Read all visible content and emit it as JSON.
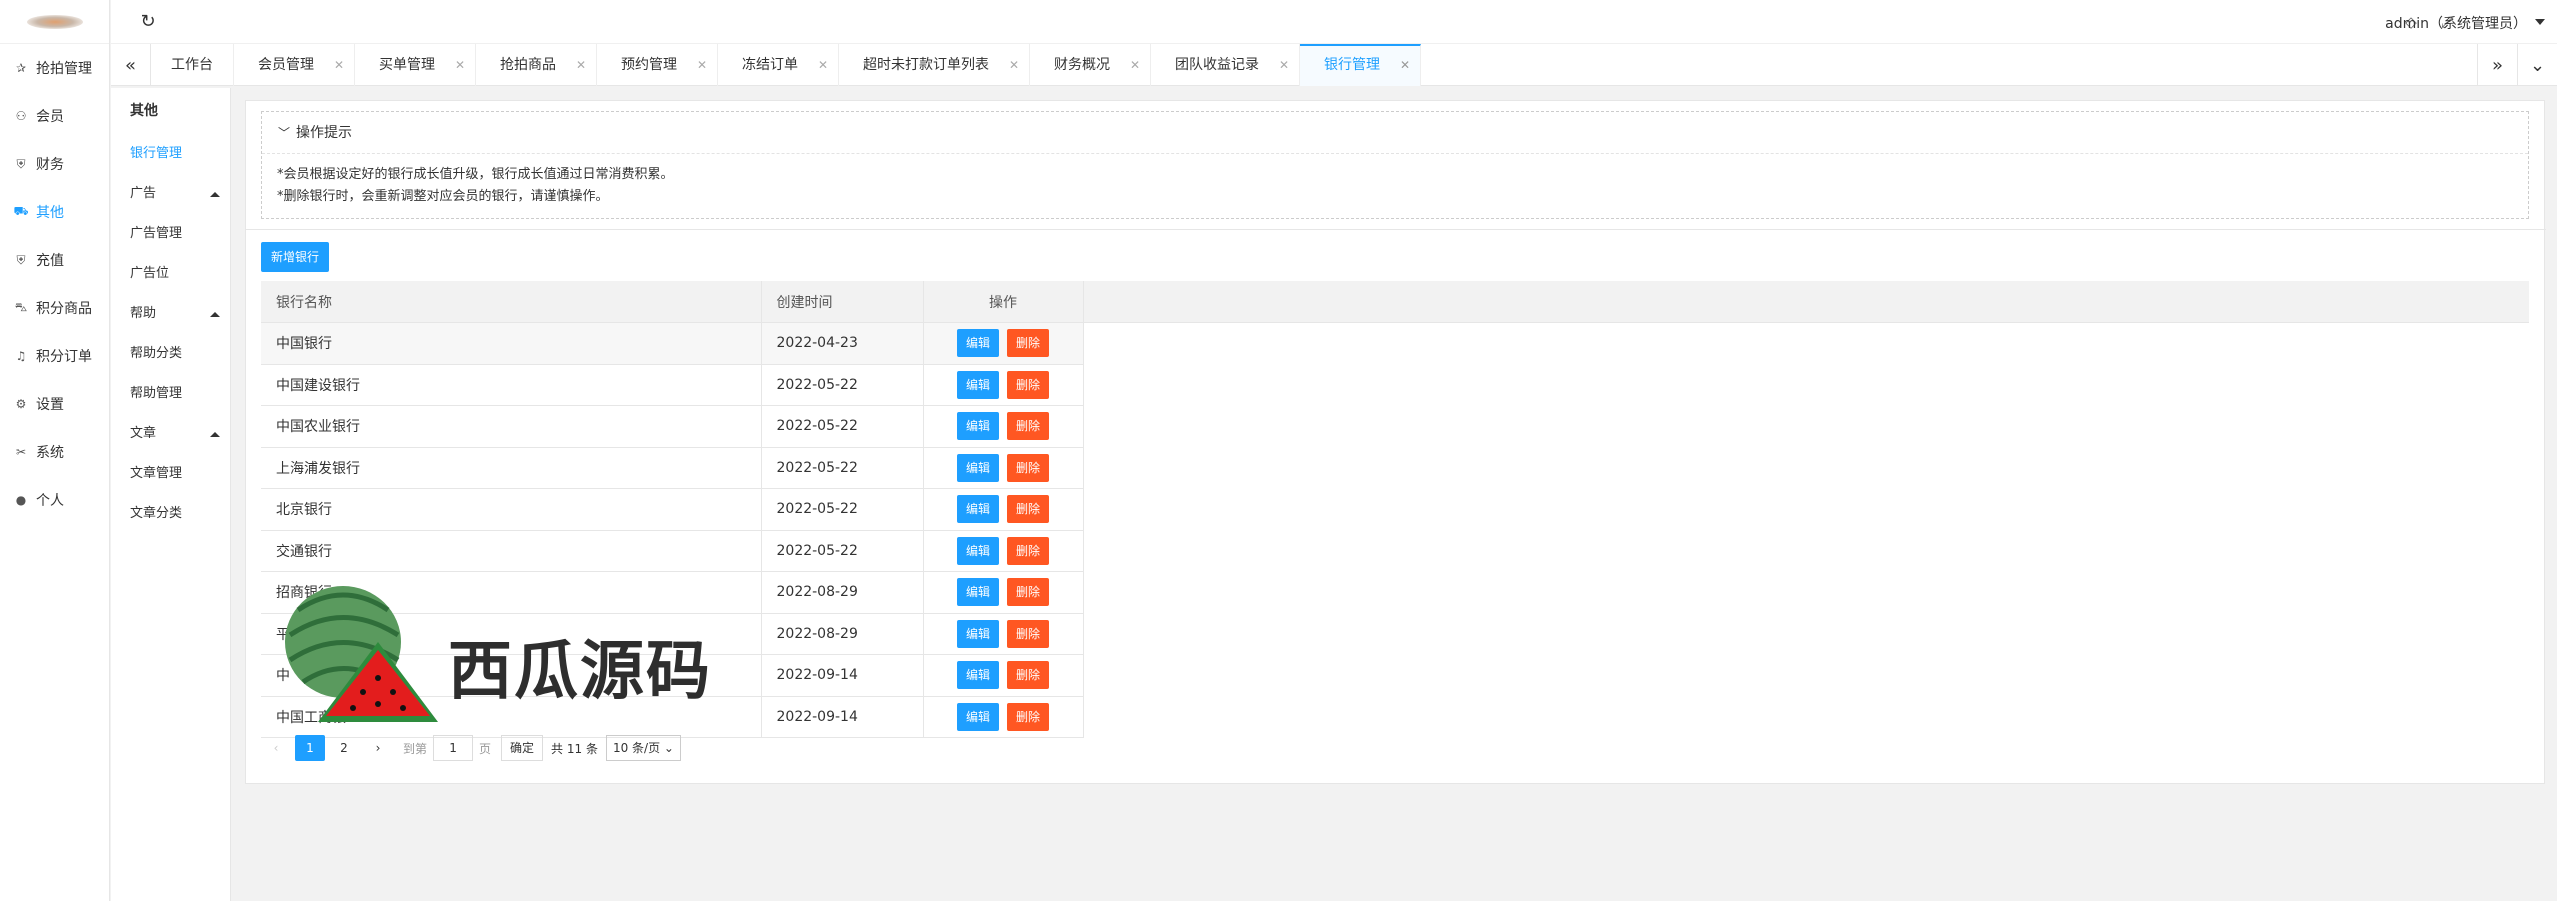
{
  "sidebar": {
    "items": [
      {
        "label": "抢拍管理",
        "icon": "star-icon",
        "glyph": "✰"
      },
      {
        "label": "会员",
        "icon": "user-icon",
        "glyph": "⚇"
      },
      {
        "label": "财务",
        "icon": "shield-icon",
        "glyph": "⛨"
      },
      {
        "label": "其他",
        "icon": "car-icon",
        "glyph": "⛟"
      },
      {
        "label": "充值",
        "icon": "shield-icon",
        "glyph": "⛨"
      },
      {
        "label": "积分商品",
        "icon": "cart-icon",
        "glyph": "⛍"
      },
      {
        "label": "积分订单",
        "icon": "bell-icon",
        "glyph": "♫"
      },
      {
        "label": "设置",
        "icon": "gear-icon",
        "glyph": "⚙"
      },
      {
        "label": "系统",
        "icon": "tools-icon",
        "glyph": "✂"
      },
      {
        "label": "个人",
        "icon": "person-icon",
        "glyph": "●"
      }
    ],
    "active_index": 3
  },
  "subnav": {
    "title": "其他",
    "bank": "银行管理",
    "ad_group": "广告",
    "ad_manage": "广告管理",
    "ad_position": "广告位",
    "help_group": "帮助",
    "help_category": "帮助分类",
    "help_manage": "帮助管理",
    "article_group": "文章",
    "article_manage": "文章管理",
    "article_category": "文章分类"
  },
  "header": {
    "user": "admin（系统管理员）"
  },
  "tabs": [
    {
      "label": "工作台",
      "closable": false
    },
    {
      "label": "会员管理",
      "closable": true
    },
    {
      "label": "买单管理",
      "closable": true
    },
    {
      "label": "抢拍商品",
      "closable": true
    },
    {
      "label": "预约管理",
      "closable": true
    },
    {
      "label": "冻结订单",
      "closable": true
    },
    {
      "label": "超时未打款订单列表",
      "closable": true
    },
    {
      "label": "财务概况",
      "closable": true
    },
    {
      "label": "团队收益记录",
      "closable": true
    },
    {
      "label": "银行管理",
      "closable": true,
      "active": true
    }
  ],
  "tips": {
    "title": "操作提示",
    "line1": "*会员根据设定好的银行成长值升级，银行成长值通过日常消费积累。",
    "line2": "*删除银行时，会重新调整对应会员的银行，请谨慎操作。"
  },
  "toolbar": {
    "add_label": "新增银行"
  },
  "table": {
    "headers": {
      "name": "银行名称",
      "created": "创建时间",
      "ops": "操作"
    },
    "edit_label": "编辑",
    "delete_label": "删除",
    "rows": [
      {
        "name": "中国银行",
        "created": "2022-04-23"
      },
      {
        "name": "中国建设银行",
        "created": "2022-05-22"
      },
      {
        "name": "中国农业银行",
        "created": "2022-05-22"
      },
      {
        "name": "上海浦发银行",
        "created": "2022-05-22"
      },
      {
        "name": "北京银行",
        "created": "2022-05-22"
      },
      {
        "name": "交通银行",
        "created": "2022-05-22"
      },
      {
        "name": "招商银行",
        "created": "2022-08-29"
      },
      {
        "name": "平",
        "created": "2022-08-29"
      },
      {
        "name": "中",
        "created": "2022-09-14"
      },
      {
        "name": "中国工商银",
        "created": "2022-09-14"
      }
    ]
  },
  "pager": {
    "pages": [
      "1",
      "2"
    ],
    "current": "1",
    "goto_label": "到第",
    "goto_value": "1",
    "page_unit": "页",
    "confirm": "确定",
    "total": "共 11 条",
    "page_size": "10 条/页"
  },
  "watermark": {
    "text": "西瓜源码"
  },
  "colors": {
    "primary": "#1E9FFF",
    "danger": "#FF5722"
  }
}
